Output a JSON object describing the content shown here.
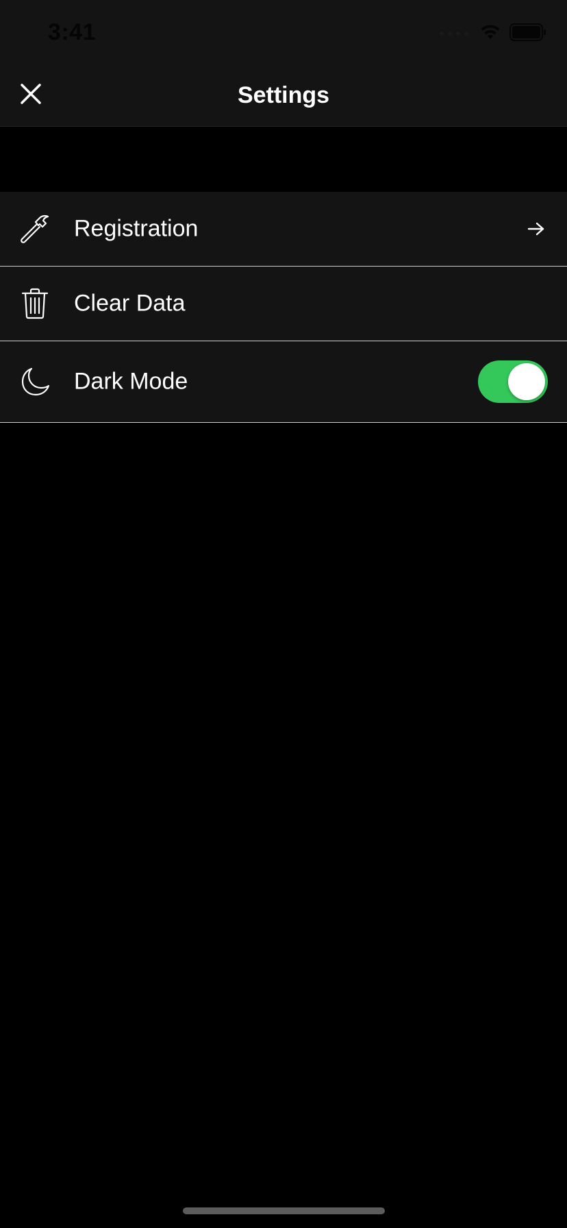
{
  "status_bar": {
    "time": "3:41",
    "icons": [
      "signal-icon",
      "wifi-icon",
      "battery-icon"
    ]
  },
  "nav": {
    "title": "Settings",
    "close_icon": "close-icon"
  },
  "settings": {
    "items": [
      {
        "label": "Registration",
        "icon": "hammer-icon",
        "accessory": "arrow-right-icon"
      },
      {
        "label": "Clear Data",
        "icon": "trash-icon",
        "accessory": "none"
      },
      {
        "label": "Dark Mode",
        "icon": "moon-icon",
        "accessory": "toggle",
        "toggle_on": true
      }
    ]
  },
  "colors": {
    "background": "#000000",
    "surface": "#141414",
    "separator": "#cfcfcf",
    "toggle_on": "#34c759",
    "text": "#ffffff"
  }
}
